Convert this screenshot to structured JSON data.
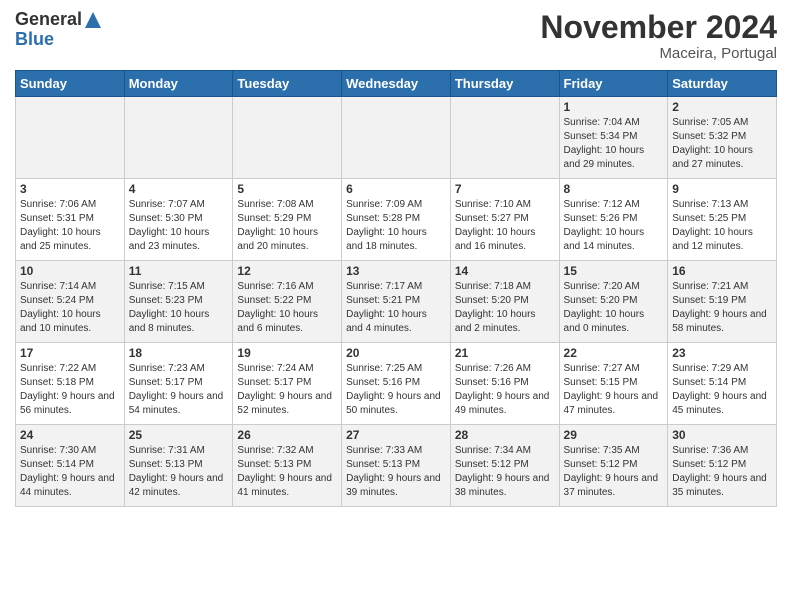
{
  "logo": {
    "general": "General",
    "blue": "Blue"
  },
  "header": {
    "month": "November 2024",
    "location": "Maceira, Portugal"
  },
  "weekdays": [
    "Sunday",
    "Monday",
    "Tuesday",
    "Wednesday",
    "Thursday",
    "Friday",
    "Saturday"
  ],
  "weeks": [
    [
      {
        "day": "",
        "info": ""
      },
      {
        "day": "",
        "info": ""
      },
      {
        "day": "",
        "info": ""
      },
      {
        "day": "",
        "info": ""
      },
      {
        "day": "",
        "info": ""
      },
      {
        "day": "1",
        "info": "Sunrise: 7:04 AM\nSunset: 5:34 PM\nDaylight: 10 hours and 29 minutes."
      },
      {
        "day": "2",
        "info": "Sunrise: 7:05 AM\nSunset: 5:32 PM\nDaylight: 10 hours and 27 minutes."
      }
    ],
    [
      {
        "day": "3",
        "info": "Sunrise: 7:06 AM\nSunset: 5:31 PM\nDaylight: 10 hours and 25 minutes."
      },
      {
        "day": "4",
        "info": "Sunrise: 7:07 AM\nSunset: 5:30 PM\nDaylight: 10 hours and 23 minutes."
      },
      {
        "day": "5",
        "info": "Sunrise: 7:08 AM\nSunset: 5:29 PM\nDaylight: 10 hours and 20 minutes."
      },
      {
        "day": "6",
        "info": "Sunrise: 7:09 AM\nSunset: 5:28 PM\nDaylight: 10 hours and 18 minutes."
      },
      {
        "day": "7",
        "info": "Sunrise: 7:10 AM\nSunset: 5:27 PM\nDaylight: 10 hours and 16 minutes."
      },
      {
        "day": "8",
        "info": "Sunrise: 7:12 AM\nSunset: 5:26 PM\nDaylight: 10 hours and 14 minutes."
      },
      {
        "day": "9",
        "info": "Sunrise: 7:13 AM\nSunset: 5:25 PM\nDaylight: 10 hours and 12 minutes."
      }
    ],
    [
      {
        "day": "10",
        "info": "Sunrise: 7:14 AM\nSunset: 5:24 PM\nDaylight: 10 hours and 10 minutes."
      },
      {
        "day": "11",
        "info": "Sunrise: 7:15 AM\nSunset: 5:23 PM\nDaylight: 10 hours and 8 minutes."
      },
      {
        "day": "12",
        "info": "Sunrise: 7:16 AM\nSunset: 5:22 PM\nDaylight: 10 hours and 6 minutes."
      },
      {
        "day": "13",
        "info": "Sunrise: 7:17 AM\nSunset: 5:21 PM\nDaylight: 10 hours and 4 minutes."
      },
      {
        "day": "14",
        "info": "Sunrise: 7:18 AM\nSunset: 5:20 PM\nDaylight: 10 hours and 2 minutes."
      },
      {
        "day": "15",
        "info": "Sunrise: 7:20 AM\nSunset: 5:20 PM\nDaylight: 10 hours and 0 minutes."
      },
      {
        "day": "16",
        "info": "Sunrise: 7:21 AM\nSunset: 5:19 PM\nDaylight: 9 hours and 58 minutes."
      }
    ],
    [
      {
        "day": "17",
        "info": "Sunrise: 7:22 AM\nSunset: 5:18 PM\nDaylight: 9 hours and 56 minutes."
      },
      {
        "day": "18",
        "info": "Sunrise: 7:23 AM\nSunset: 5:17 PM\nDaylight: 9 hours and 54 minutes."
      },
      {
        "day": "19",
        "info": "Sunrise: 7:24 AM\nSunset: 5:17 PM\nDaylight: 9 hours and 52 minutes."
      },
      {
        "day": "20",
        "info": "Sunrise: 7:25 AM\nSunset: 5:16 PM\nDaylight: 9 hours and 50 minutes."
      },
      {
        "day": "21",
        "info": "Sunrise: 7:26 AM\nSunset: 5:16 PM\nDaylight: 9 hours and 49 minutes."
      },
      {
        "day": "22",
        "info": "Sunrise: 7:27 AM\nSunset: 5:15 PM\nDaylight: 9 hours and 47 minutes."
      },
      {
        "day": "23",
        "info": "Sunrise: 7:29 AM\nSunset: 5:14 PM\nDaylight: 9 hours and 45 minutes."
      }
    ],
    [
      {
        "day": "24",
        "info": "Sunrise: 7:30 AM\nSunset: 5:14 PM\nDaylight: 9 hours and 44 minutes."
      },
      {
        "day": "25",
        "info": "Sunrise: 7:31 AM\nSunset: 5:13 PM\nDaylight: 9 hours and 42 minutes."
      },
      {
        "day": "26",
        "info": "Sunrise: 7:32 AM\nSunset: 5:13 PM\nDaylight: 9 hours and 41 minutes."
      },
      {
        "day": "27",
        "info": "Sunrise: 7:33 AM\nSunset: 5:13 PM\nDaylight: 9 hours and 39 minutes."
      },
      {
        "day": "28",
        "info": "Sunrise: 7:34 AM\nSunset: 5:12 PM\nDaylight: 9 hours and 38 minutes."
      },
      {
        "day": "29",
        "info": "Sunrise: 7:35 AM\nSunset: 5:12 PM\nDaylight: 9 hours and 37 minutes."
      },
      {
        "day": "30",
        "info": "Sunrise: 7:36 AM\nSunset: 5:12 PM\nDaylight: 9 hours and 35 minutes."
      }
    ]
  ]
}
